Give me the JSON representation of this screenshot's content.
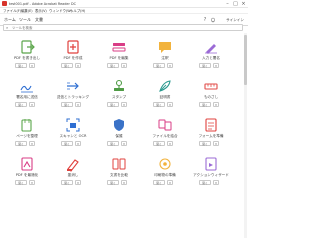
{
  "window": {
    "title": "test001.pdf - Adobe Acrobat Reader DC",
    "minimize": "–",
    "maximize": "□",
    "close": "×"
  },
  "menubar": [
    "ファイル(F)",
    "編集(E)",
    "表示(V)",
    "ウィンドウ(W)",
    "ヘルプ(H)"
  ],
  "tabs": {
    "home": "ホーム",
    "tools": "ツール",
    "document": "文書"
  },
  "topbar": {
    "help": "?",
    "signin": "サインイン"
  },
  "search": {
    "placeholder": "ツールを検索"
  },
  "tools": [
    {
      "label": "PDF を書き出し",
      "color": "#5aa54a",
      "icon": "export-pdf-icon"
    },
    {
      "label": "PDF を作成",
      "color": "#e0413d",
      "icon": "create-pdf-icon"
    },
    {
      "label": "PDF を編集",
      "color": "#d93d86",
      "icon": "edit-pdf-icon"
    },
    {
      "label": "注釈",
      "color": "#f2b33d",
      "icon": "comment-icon"
    },
    {
      "label": "入力と署名",
      "color": "#9b6bd6",
      "icon": "fill-sign-icon"
    },
    {
      "label": "署名用に送信",
      "color": "#2f6fd2",
      "icon": "send-for-signature-icon"
    },
    {
      "label": "送信とトラッキング",
      "color": "#2f6fd2",
      "icon": "send-track-icon"
    },
    {
      "label": "スタンプ",
      "color": "#4f9b45",
      "icon": "stamp-icon"
    },
    {
      "label": "証明書",
      "color": "#2b9a8f",
      "icon": "certificate-icon"
    },
    {
      "label": "ものさし",
      "color": "#e14a46",
      "icon": "measure-icon"
    },
    {
      "label": "ページを整理",
      "color": "#5aa54a",
      "icon": "organize-pages-icon"
    },
    {
      "label": "スキャンと OCR",
      "color": "#2f6fd2",
      "icon": "scan-ocr-icon"
    },
    {
      "label": "保護",
      "color": "#3a72c7",
      "icon": "protect-icon"
    },
    {
      "label": "ファイルを結合",
      "color": "#d93d86",
      "icon": "combine-files-icon"
    },
    {
      "label": "フォームを準備",
      "color": "#e0413d",
      "icon": "prepare-form-icon"
    },
    {
      "label": "PDF を最適化",
      "color": "#d93d86",
      "icon": "optimize-pdf-icon"
    },
    {
      "label": "墨消し",
      "color": "#e0413d",
      "icon": "redact-icon"
    },
    {
      "label": "文書を比較",
      "color": "#e0413d",
      "icon": "compare-icon"
    },
    {
      "label": "印刷物の準備",
      "color": "#f2b33d",
      "icon": "print-production-icon"
    },
    {
      "label": "アクションウィザード",
      "color": "#9b6bd6",
      "icon": "action-wizard-icon"
    }
  ],
  "tool_buttons": {
    "open": "開く",
    "menu": "▾"
  },
  "colors": {
    "accent": "#1473e6",
    "border": "#c9c9c9"
  }
}
